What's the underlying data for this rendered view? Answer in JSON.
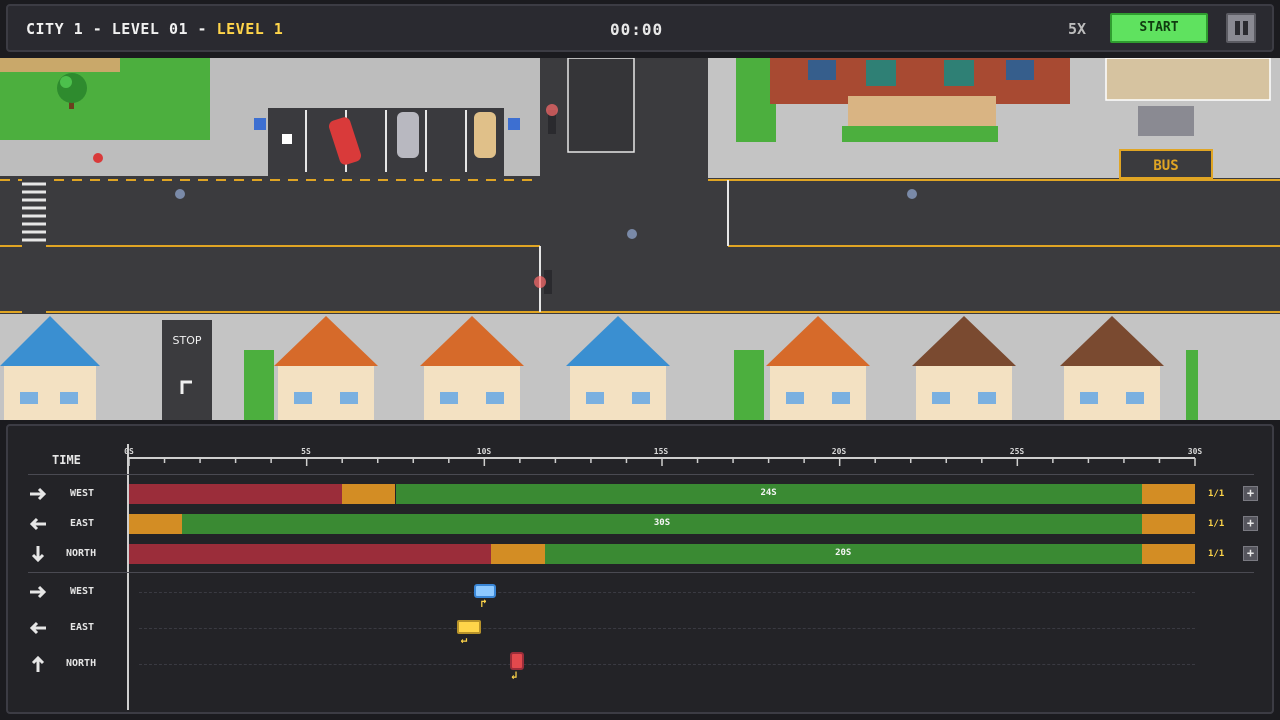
{
  "header": {
    "level_prefix": "CITY 1 - LEVEL 01 - ",
    "level_name": "LEVEL 1",
    "timer": "00:00",
    "speed": "5X",
    "start_label": "START"
  },
  "map": {
    "stop_label": "STOP",
    "bus_label": "BUS",
    "parking_label": "P"
  },
  "timeline": {
    "time_label": "TIME",
    "ticks": [
      "0S",
      "5S",
      "10S",
      "15S",
      "20S",
      "25S",
      "30S"
    ],
    "lights": [
      {
        "direction": "WEST",
        "segments": [
          {
            "color": "red",
            "start": 0,
            "end": 6
          },
          {
            "color": "yellow",
            "start": 6,
            "end": 7.5
          },
          {
            "color": "green",
            "start": 7.5,
            "end": 28.5
          },
          {
            "color": "yellow",
            "start": 28.5,
            "end": 30
          }
        ],
        "green_label": "24S",
        "count": "1/1"
      },
      {
        "direction": "EAST",
        "segments": [
          {
            "color": "yellow",
            "start": 0,
            "end": 1.5
          },
          {
            "color": "green",
            "start": 1.5,
            "end": 28.5
          },
          {
            "color": "yellow",
            "start": 28.5,
            "end": 30
          }
        ],
        "green_label": "30S",
        "count": "1/1"
      },
      {
        "direction": "NORTH",
        "segments": [
          {
            "color": "red",
            "start": 0,
            "end": 10.2
          },
          {
            "color": "yellow",
            "start": 10.2,
            "end": 11.7
          },
          {
            "color": "green",
            "start": 11.7,
            "end": 28.5
          },
          {
            "color": "yellow",
            "start": 28.5,
            "end": 30
          }
        ],
        "green_label": "20S",
        "count": "1/1"
      }
    ],
    "vehicles": [
      {
        "direction": "WEST",
        "time": 10
      },
      {
        "direction": "EAST",
        "time": 9.5
      },
      {
        "direction": "NORTH",
        "time": 11
      }
    ],
    "colors": {
      "red": "#9b2d3a",
      "yellow": "#d38d24",
      "green": "#3a8a33",
      "accent": "#ffd54a"
    }
  }
}
